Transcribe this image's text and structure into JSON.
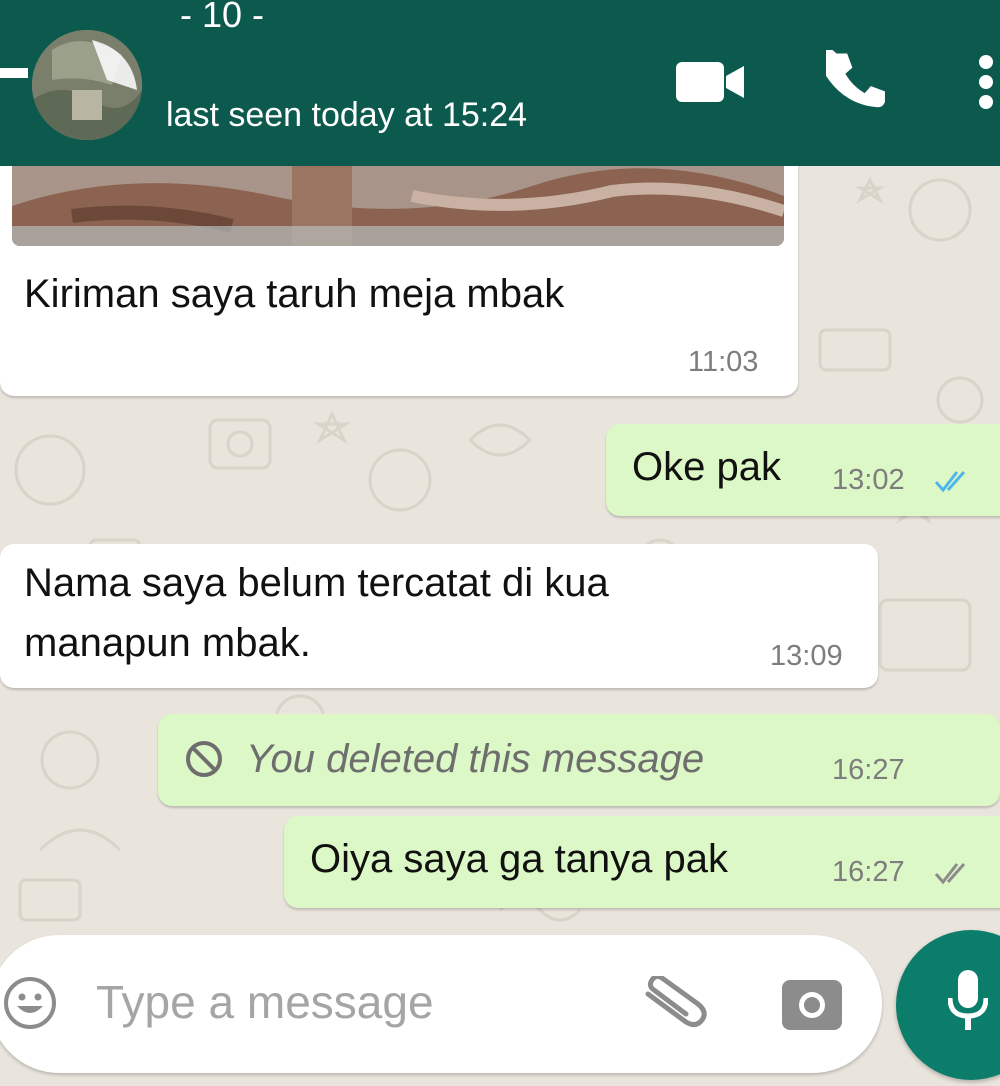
{
  "header": {
    "contact_name_partial": "- 10 -",
    "status": "last seen today at 15:24",
    "icons": [
      "back-arrow",
      "avatar",
      "video-call-icon",
      "voice-call-icon",
      "more-options-icon"
    ]
  },
  "messages": [
    {
      "direction": "incoming",
      "text": "Kiriman saya taruh meja mbak",
      "time": "11:03",
      "has_photo": true
    },
    {
      "direction": "outgoing",
      "text": "Oke pak",
      "time": "13:02",
      "ticks": "read"
    },
    {
      "direction": "incoming",
      "text_line1": "Nama saya belum tercatat di kua",
      "text_line2": "manapun mbak.",
      "time": "13:09"
    },
    {
      "direction": "outgoing",
      "text": "You deleted this message",
      "time": "16:27",
      "deleted": true
    },
    {
      "direction": "outgoing",
      "text": "Oiya saya ga tanya pak",
      "time": "16:27",
      "ticks": "delivered"
    }
  ],
  "composer": {
    "placeholder": "Type a message",
    "icons": [
      "emoji-icon",
      "attach-icon",
      "camera-icon",
      "mic-icon"
    ]
  },
  "colors": {
    "header": "#0c5a4e",
    "outgoing_bubble": "#dcf8c6",
    "incoming_bubble": "#ffffff",
    "read_ticks": "#4fb6ec",
    "mic_button": "#0c7d6b",
    "wallpaper": "#e9e4dc"
  }
}
